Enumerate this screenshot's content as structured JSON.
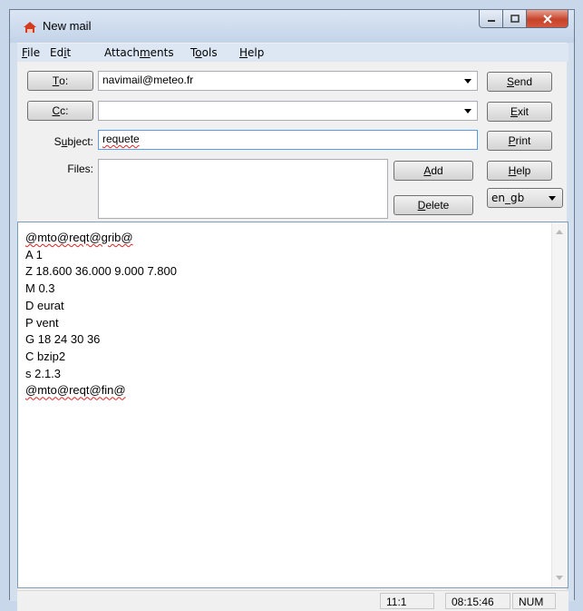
{
  "window": {
    "title": "New mail"
  },
  "menu": [
    {
      "pre": "",
      "u": "F",
      "post": "ile"
    },
    {
      "pre": "Ed",
      "u": "i",
      "post": "t"
    },
    {
      "pre": "Attach",
      "u": "m",
      "post": "ents"
    },
    {
      "pre": "T",
      "u": "o",
      "post": "ols"
    },
    {
      "pre": "",
      "u": "H",
      "post": "elp"
    }
  ],
  "to": {
    "btn_u": "T",
    "btn_rest": "o:",
    "value": "navimail@meteo.fr"
  },
  "cc": {
    "btn_u": "C",
    "btn_rest": "c:",
    "value": ""
  },
  "subject": {
    "label_pre": "S",
    "label_u": "u",
    "label_post": "bject:",
    "value": "requete"
  },
  "files": {
    "label": "Files:",
    "add_u": "A",
    "add_rest": "dd",
    "delete_u": "D",
    "delete_rest": "elete"
  },
  "actions": {
    "send_u": "S",
    "send_rest": "end",
    "exit_u": "E",
    "exit_rest": "xit",
    "print_u": "P",
    "print_rest": "rint",
    "help_u": "H",
    "help_rest": "elp",
    "language": "en_gb"
  },
  "body_lines": [
    "@mto@reqt@grib@",
    "A 1",
    "Z 18.600 36.000 9.000 7.800",
    "M 0.3",
    "D eurat",
    "P vent",
    "G 18 24 30 36",
    "C bzip2",
    "s 2.1.3",
    "@mto@reqt@fin@"
  ],
  "status": {
    "position": "11:1",
    "time": "08:15:46",
    "num": "NUM"
  }
}
